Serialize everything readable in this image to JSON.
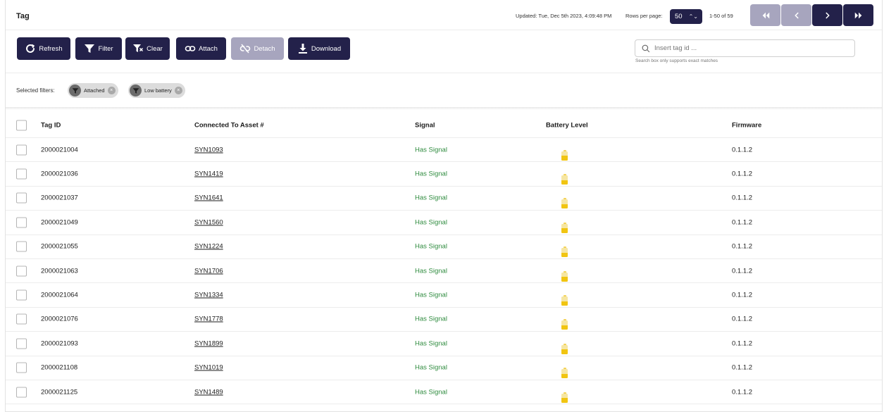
{
  "header": {
    "title": "Tag",
    "updated": "Updated: Tue, Dec 5th 2023, 4:09:48 PM",
    "rows_per_page_label": "Rows per page:",
    "rows_per_page_value": "50",
    "page_range": "1-50 of 59"
  },
  "pagination": {
    "first_icon": "double-chevron-left-icon",
    "prev_icon": "chevron-left-icon",
    "next_icon": "chevron-right-icon",
    "last_icon": "double-chevron-right-icon",
    "disabled_color": "#a7a5be",
    "enabled_color": "#23214a"
  },
  "toolbar": {
    "refresh_label": "Refresh",
    "filter_label": "Filter",
    "clear_label": "Clear",
    "attach_label": "Attach",
    "detach_label": "Detach",
    "download_label": "Download",
    "search_placeholder": "Insert tag id ...",
    "search_hint": "Search box only supports exact matches",
    "accent_color": "#23214a"
  },
  "filters": {
    "label": "Selected filters:",
    "chips": [
      {
        "label": "Attached"
      },
      {
        "label": "Low battery"
      }
    ]
  },
  "table": {
    "columns": [
      "Tag ID",
      "Connected To Asset #",
      "Signal",
      "Battery Level",
      "Firmware"
    ],
    "battery_level_fraction": 0.5,
    "signal_color": "#2e8b3e",
    "battery_color": "#f1c512",
    "rows": [
      {
        "tag_id": "2000021004",
        "asset": "SYN1093",
        "signal": "Has Signal",
        "firmware": "0.1.1.2"
      },
      {
        "tag_id": "2000021036",
        "asset": "SYN1419",
        "signal": "Has Signal",
        "firmware": "0.1.1.2"
      },
      {
        "tag_id": "2000021037",
        "asset": "SYN1641",
        "signal": "Has Signal",
        "firmware": "0.1.1.2"
      },
      {
        "tag_id": "2000021049",
        "asset": "SYN1560",
        "signal": "Has Signal",
        "firmware": "0.1.1.2"
      },
      {
        "tag_id": "2000021055",
        "asset": "SYN1224",
        "signal": "Has Signal",
        "firmware": "0.1.1.2"
      },
      {
        "tag_id": "2000021063",
        "asset": "SYN1706",
        "signal": "Has Signal",
        "firmware": "0.1.1.2"
      },
      {
        "tag_id": "2000021064",
        "asset": "SYN1334",
        "signal": "Has Signal",
        "firmware": "0.1.1.2"
      },
      {
        "tag_id": "2000021076",
        "asset": "SYN1778",
        "signal": "Has Signal",
        "firmware": "0.1.1.2"
      },
      {
        "tag_id": "2000021093",
        "asset": "SYN1899",
        "signal": "Has Signal",
        "firmware": "0.1.1.2"
      },
      {
        "tag_id": "2000021108",
        "asset": "SYN1019",
        "signal": "Has Signal",
        "firmware": "0.1.1.2"
      },
      {
        "tag_id": "2000021125",
        "asset": "SYN1489",
        "signal": "Has Signal",
        "firmware": "0.1.1.2"
      }
    ]
  }
}
